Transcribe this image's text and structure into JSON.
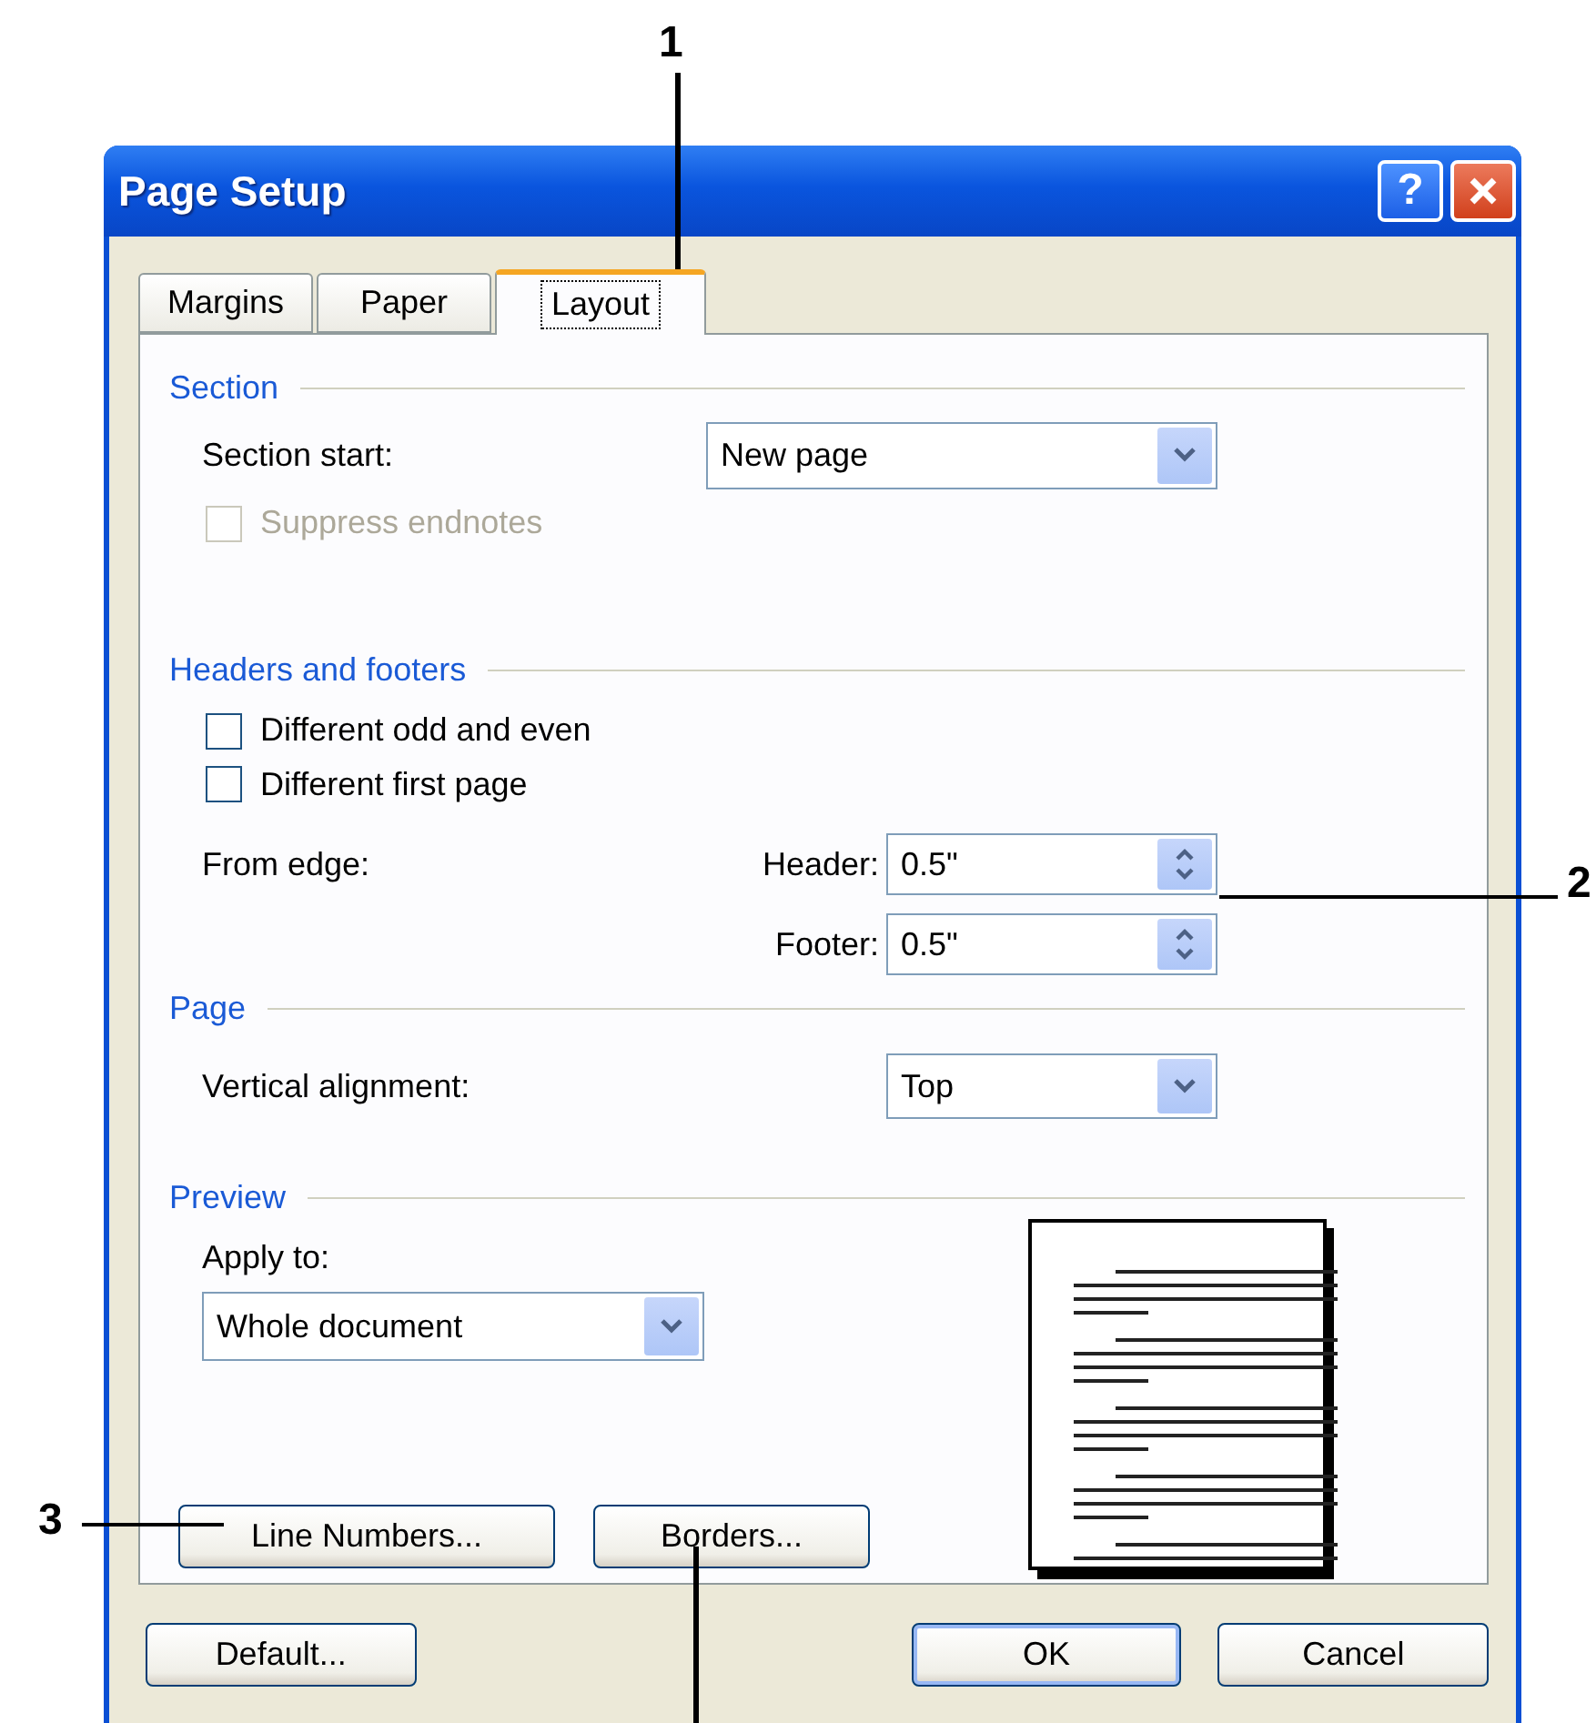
{
  "callouts": [
    {
      "label": "1"
    },
    {
      "label": "2"
    },
    {
      "label": "3"
    }
  ],
  "window": {
    "title": "Page Setup",
    "help_button": "?"
  },
  "tabs": [
    {
      "label": "Margins",
      "selected": false
    },
    {
      "label": "Paper",
      "selected": false
    },
    {
      "label": "Layout",
      "selected": true
    }
  ],
  "section": {
    "legend": "Section",
    "section_start": {
      "label": "Section start:",
      "value": "New page"
    },
    "suppress_endnotes": {
      "label": "Suppress endnotes",
      "checked": false,
      "disabled": true
    }
  },
  "headers_and_footers": {
    "legend": "Headers and footers",
    "checkboxes": [
      {
        "label": "Different odd and even",
        "checked": false,
        "disabled": false
      },
      {
        "label": "Different first page",
        "checked": false,
        "disabled": false
      }
    ],
    "from_edge": "From edge:",
    "header": {
      "label": "Header:",
      "value": "0.5\""
    },
    "footer": {
      "label": "Footer:",
      "value": "0.5\""
    }
  },
  "page": {
    "legend": "Page",
    "vertical_alignment": {
      "label": "Vertical alignment:",
      "value": "Top"
    }
  },
  "preview": {
    "legend": "Preview",
    "apply_to": {
      "label": "Apply to:",
      "value": "Whole document"
    }
  },
  "panel_buttons": [
    {
      "label": "Line Numbers..."
    },
    {
      "label": "Borders..."
    }
  ],
  "dialog_buttons": [
    {
      "label": "Default...",
      "default": false
    },
    {
      "label": "OK",
      "default": true
    },
    {
      "label": "Cancel",
      "default": false
    }
  ]
}
